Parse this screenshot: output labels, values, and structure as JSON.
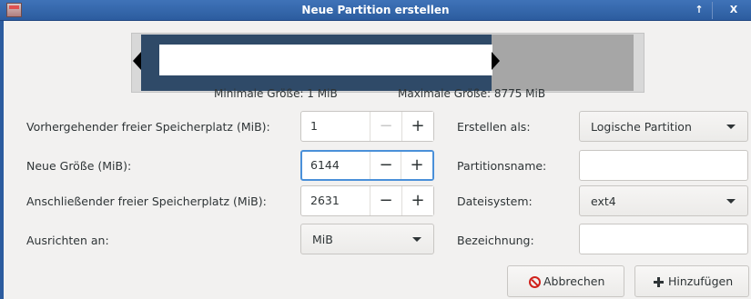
{
  "window": {
    "title": "Neue Partition erstellen",
    "maximize_glyph": "↑",
    "close_glyph": "X"
  },
  "partition_graphic": {
    "min_size_label": "Minimale Größe: 1 MiB",
    "max_size_label": "Maximale Größe: 8775 MiB",
    "selected_fraction": 0.7,
    "colors": {
      "selected": "#2f4a68",
      "unallocated": "#a6a6a6"
    }
  },
  "form": {
    "free_before": {
      "label": "Vorhergehender freier Speicherplatz (MiB):",
      "value": "1"
    },
    "new_size": {
      "label": "Neue Größe (MiB):",
      "value": "6144"
    },
    "free_after": {
      "label": "Anschließender freier Speicherplatz (MiB):",
      "value": "2631"
    },
    "align": {
      "label": "Ausrichten an:",
      "value": "MiB"
    },
    "create_as": {
      "label": "Erstellen als:",
      "value": "Logische Partition"
    },
    "partition_name": {
      "label": "Partitionsname:",
      "value": ""
    },
    "filesystem": {
      "label": "Dateisystem:",
      "value": "ext4"
    },
    "fs_label": {
      "label": "Bezeichnung:",
      "value": ""
    }
  },
  "spin_glyphs": {
    "minus": "−",
    "plus": "+"
  },
  "buttons": {
    "cancel": "Abbrechen",
    "add": "Hinzufügen"
  },
  "icons": {
    "cancel": "cancel-icon",
    "add": "plus-icon",
    "app": "gparted-icon"
  }
}
